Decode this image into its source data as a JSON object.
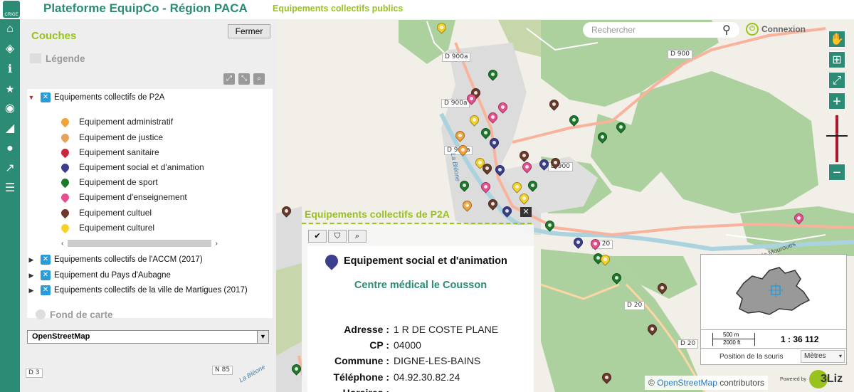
{
  "header": {
    "logo_text": "CRIGE",
    "title": "Plateforme EquipCo - Région PACA",
    "subtitle": "Equipements collectifs publics"
  },
  "nav": {
    "items": [
      "home-icon",
      "layers-icon",
      "info-icon",
      "star-icon",
      "locate-icon",
      "measure-icon",
      "comment-icon",
      "share-icon",
      "list-icon"
    ]
  },
  "dock": {
    "title": "Couches",
    "close_label": "Fermer",
    "legend_label": "Légende",
    "basemap_section": "Fond de carte",
    "basemap_selected": "OpenStreetMap",
    "groups": [
      {
        "label": "Equipements collectifs de P2A",
        "expanded": true
      },
      {
        "label": "Equipements collectifs de l'ACCM (2017)",
        "expanded": false
      },
      {
        "label": "Equipement du Pays d'Aubagne",
        "expanded": false
      },
      {
        "label": "Equipements collectifs de la ville de Martigues (2017)",
        "expanded": false
      }
    ],
    "legend_items": [
      {
        "label": "Equipement administratif",
        "color": "#f2a33a"
      },
      {
        "label": "Equipement de justice",
        "color": "#e8a35a"
      },
      {
        "label": "Equipement sanitaire",
        "color": "#c8283a"
      },
      {
        "label": "Equipement social et d'animation",
        "color": "#3b3f8c"
      },
      {
        "label": "Equipement de sport",
        "color": "#1d7a2a"
      },
      {
        "label": "Equipement d'enseignement",
        "color": "#e84f8f"
      },
      {
        "label": "Equipement cultuel",
        "color": "#6b3a2a"
      },
      {
        "label": "Equipement culturel",
        "color": "#f5d22a"
      }
    ]
  },
  "search": {
    "placeholder": "Rechercher"
  },
  "connexion_label": "Connexion",
  "map": {
    "road_labels": [
      "D 900a",
      "D 900",
      "D 900a",
      "D 900a",
      "D 900",
      "D 20",
      "D 20",
      "D 20",
      "D 3",
      "N 85"
    ],
    "street_labels": [
      "La Bléone",
      "Chemin de Mouroues",
      "La Bléone"
    ]
  },
  "popup": {
    "title": "Equipements collectifs de P2A",
    "close": "✕",
    "feature_type": "Equipement social et d'animation",
    "feature_name": "Centre médical le Cousson",
    "attributes": [
      {
        "key": "Adresse :",
        "value": "1 R DE COSTE PLANE"
      },
      {
        "key": "CP :",
        "value": "04000"
      },
      {
        "key": "Commune :",
        "value": "DIGNE-LES-BAINS"
      },
      {
        "key": "Téléphone :",
        "value": "04.92.30.82.24"
      },
      {
        "key": "Horaires :",
        "value": ""
      }
    ]
  },
  "overview": {
    "scale_m": "500 m",
    "scale_ft": "2000 ft",
    "scale_ratio": "1 : 36 112",
    "position_label": "Position de la souris",
    "units": "Mètres"
  },
  "attribution": {
    "prefix": "©",
    "link": "OpenStreetMap",
    "suffix": "contributors",
    "powered": "Powered by",
    "brand": "3Liz"
  }
}
